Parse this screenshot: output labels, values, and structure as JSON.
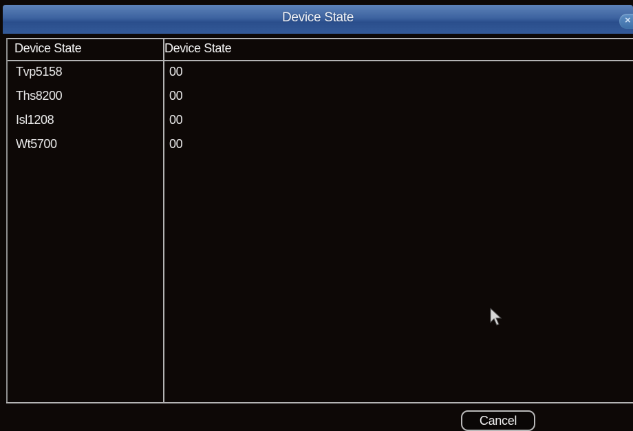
{
  "window": {
    "title": "Device State",
    "close_icon": "close-icon"
  },
  "table": {
    "headers": [
      "Device State",
      "Device State"
    ],
    "rows": [
      {
        "device": "Tvp5158",
        "state": "00"
      },
      {
        "device": "Ths8200",
        "state": "00"
      },
      {
        "device": "Isl1208",
        "state": "00"
      },
      {
        "device": "Wt5700",
        "state": "00"
      }
    ]
  },
  "footer": {
    "cancel_label": "Cancel"
  },
  "colors": {
    "titlebar": "#3d63a0",
    "background": "#0a0706",
    "text": "#e8e8e8"
  }
}
